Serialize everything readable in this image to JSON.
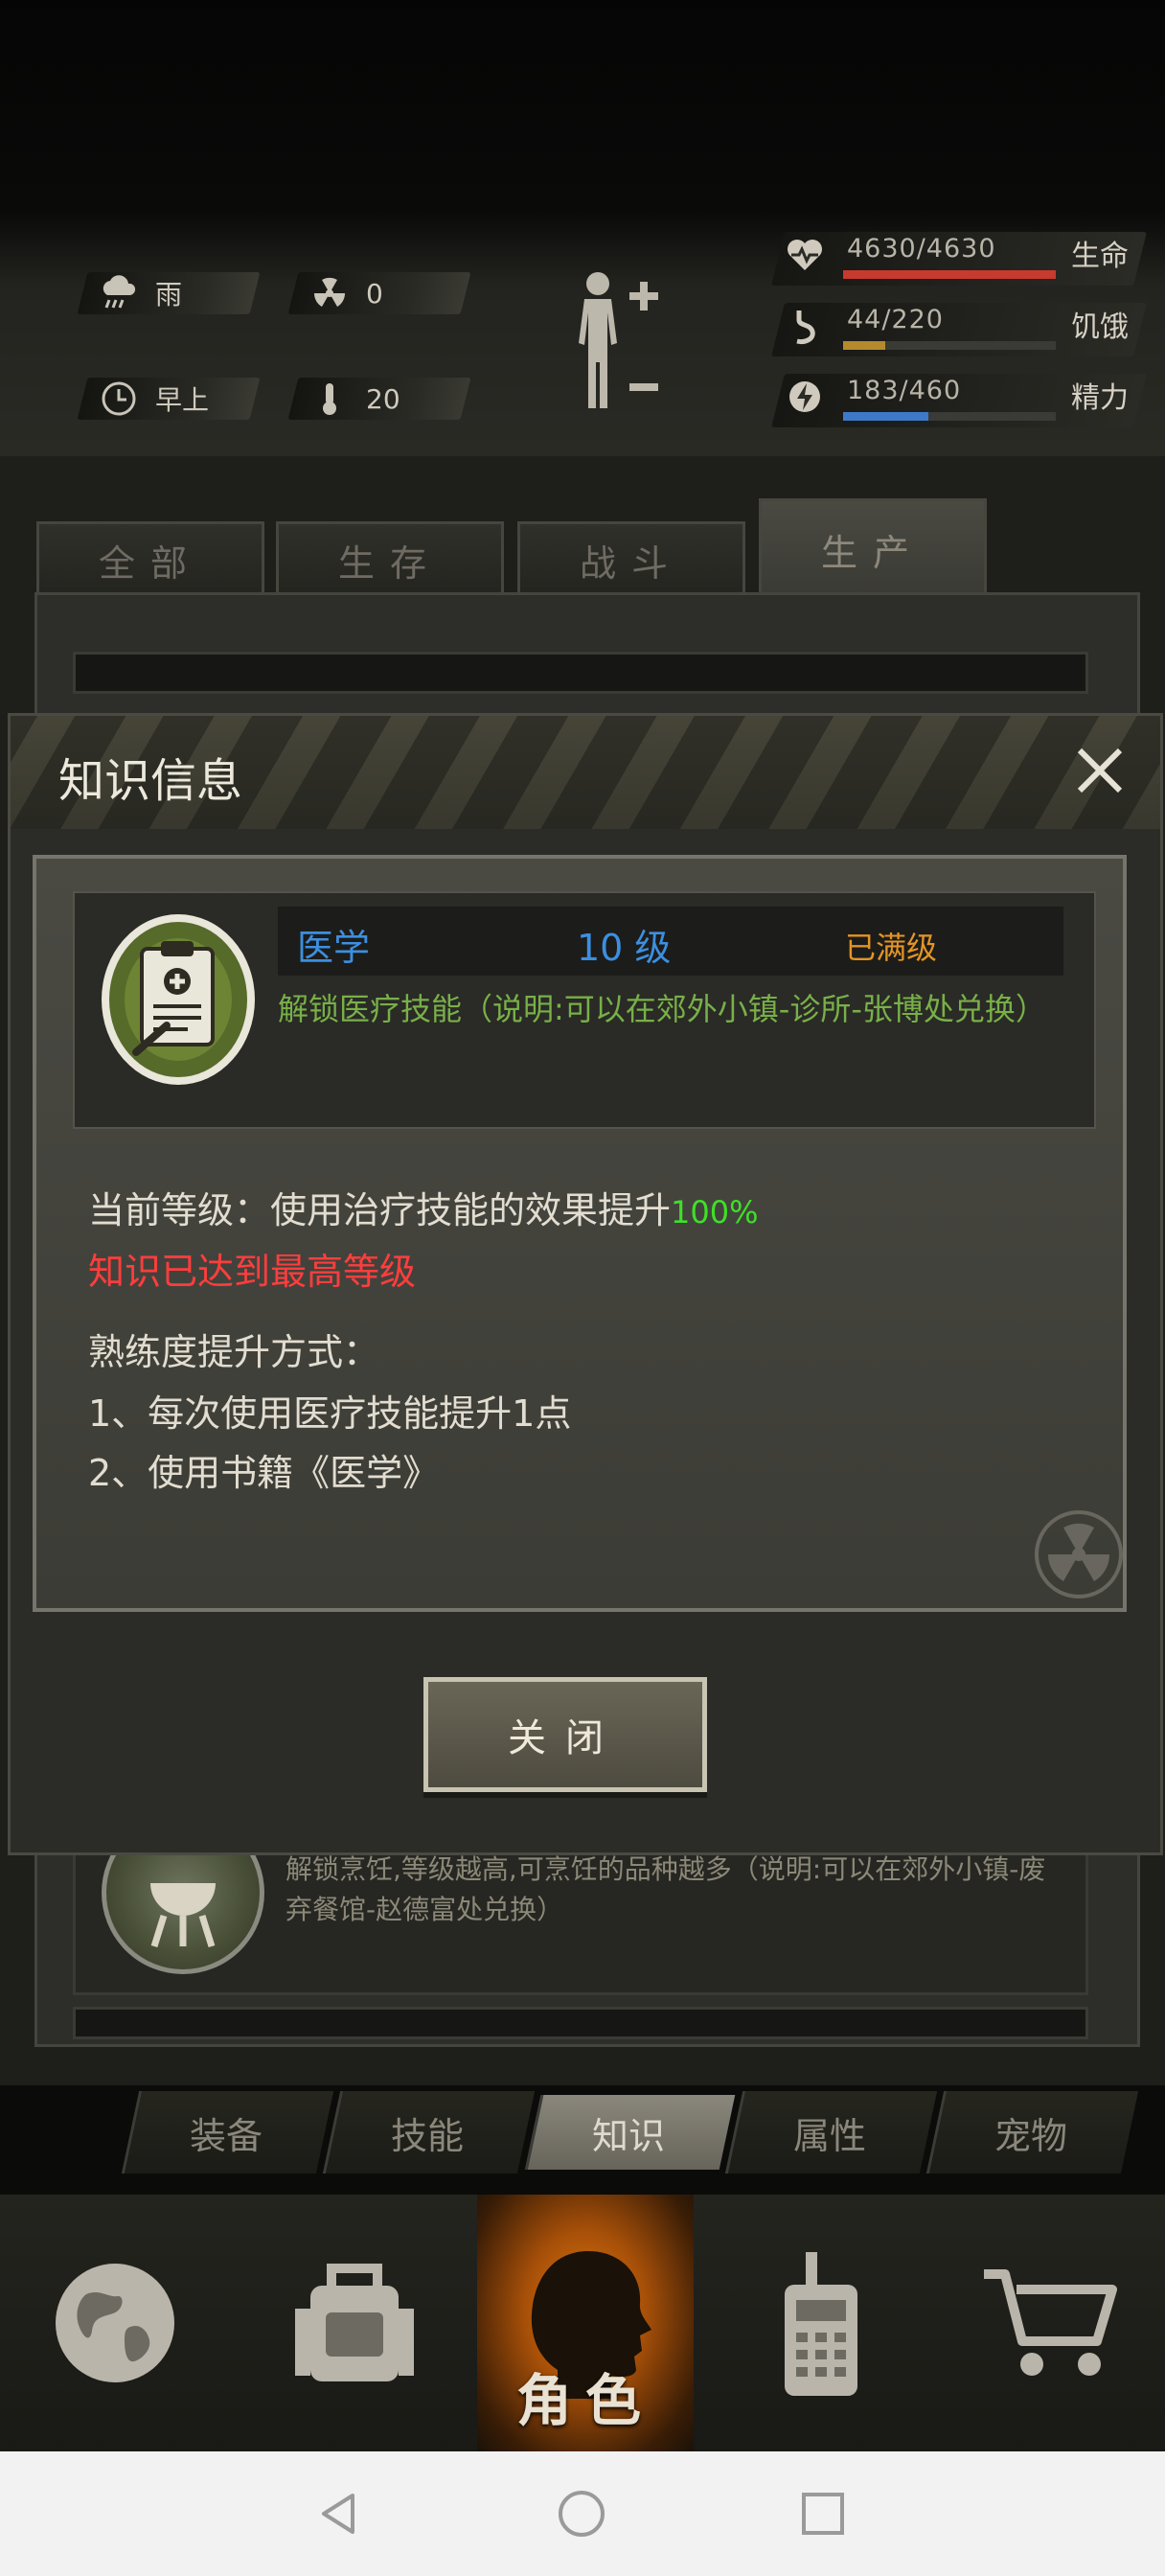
{
  "status": {
    "weather": "雨",
    "radiation": "0",
    "time_of_day": "早上",
    "temperature": "20",
    "vitals": [
      {
        "icon": "heart-icon",
        "value": "4630/4630",
        "label": "生命",
        "fill": 1.0,
        "color": "#c73a2e"
      },
      {
        "icon": "stomach-icon",
        "value": "44/220",
        "label": "饥饿",
        "fill": 0.2,
        "color": "#b48a2c"
      },
      {
        "icon": "energy-icon",
        "value": "183/460",
        "label": "精力",
        "fill": 0.4,
        "color": "#3e79c9"
      }
    ]
  },
  "category_tabs": [
    "全部",
    "生存",
    "战斗",
    "生产"
  ],
  "background_item": {
    "desc": "解锁烹饪,等级越高,可烹饪的品种越多（说明:可以在郊外小镇-废弃餐馆-赵德富处兑换）"
  },
  "sub_tabs": [
    "装备",
    "技能",
    "知识",
    "属性",
    "宠物"
  ],
  "bottom_nav": {
    "active_label": "角色"
  },
  "modal": {
    "title": "知识信息",
    "skill_name": "医学",
    "skill_level": "10 级",
    "skill_max": "已满级",
    "skill_desc": "解锁医疗技能（说明:可以在郊外小镇-诊所-张博处兑换）",
    "current_level_prefix": "当前等级：使用治疗技能的效果提升",
    "current_level_value": "100%",
    "max_notice": "知识已达到最高等级",
    "method_title": "熟练度提升方式：",
    "method_1": "1、每次使用医疗技能提升1点",
    "method_2": "2、使用书籍《医学》",
    "close_label": "关闭"
  }
}
